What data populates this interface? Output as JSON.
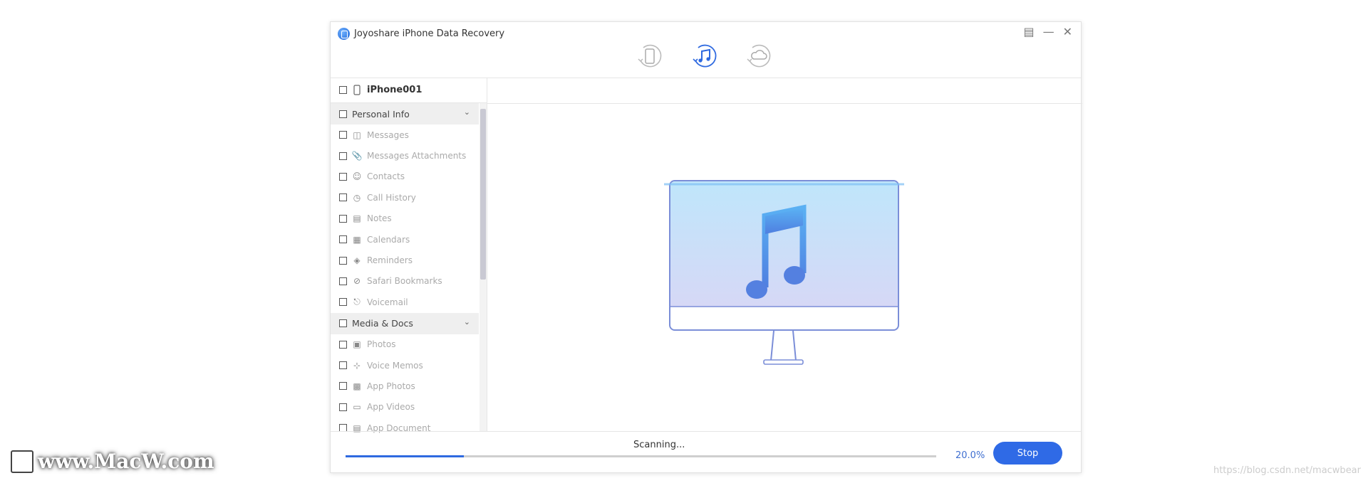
{
  "window": {
    "title": "Joyoshare iPhone Data Recovery",
    "modes": [
      {
        "icon": "device-recover-icon",
        "active": false
      },
      {
        "icon": "itunes-recover-icon",
        "active": true
      },
      {
        "icon": "icloud-recover-icon",
        "active": false
      }
    ],
    "controls": [
      "menu-icon",
      "minimize-icon",
      "close-icon"
    ]
  },
  "sidebar": {
    "device": "iPhone001",
    "groups": [
      {
        "label": "Personal Info",
        "items": [
          {
            "label": "Messages",
            "icon": "message-icon"
          },
          {
            "label": "Messages Attachments",
            "icon": "paperclip-icon"
          },
          {
            "label": "Contacts",
            "icon": "person-icon"
          },
          {
            "label": "Call History",
            "icon": "clock-icon"
          },
          {
            "label": "Notes",
            "icon": "notes-icon"
          },
          {
            "label": "Calendars",
            "icon": "calendar-icon"
          },
          {
            "label": "Reminders",
            "icon": "tag-icon"
          },
          {
            "label": "Safari Bookmarks",
            "icon": "compass-icon"
          },
          {
            "label": "Voicemail",
            "icon": "microphone-icon"
          }
        ]
      },
      {
        "label": "Media & Docs",
        "items": [
          {
            "label": "Photos",
            "icon": "camera-icon"
          },
          {
            "label": "Voice Memos",
            "icon": "waveform-icon"
          },
          {
            "label": "App Photos",
            "icon": "image-icon"
          },
          {
            "label": "App Videos",
            "icon": "video-icon"
          },
          {
            "label": "App Document",
            "icon": "document-icon"
          }
        ]
      }
    ]
  },
  "main": {
    "illustration": "monitor-with-music-note"
  },
  "footer": {
    "status": "Scanning...",
    "progress_percent": 20.0,
    "progress_label": "20.0%",
    "stop_label": "Stop"
  },
  "colors": {
    "accent": "#2f6ae6"
  },
  "watermarks": {
    "left": "www.MacW.com",
    "right": "https://blog.csdn.net/macwbear"
  }
}
